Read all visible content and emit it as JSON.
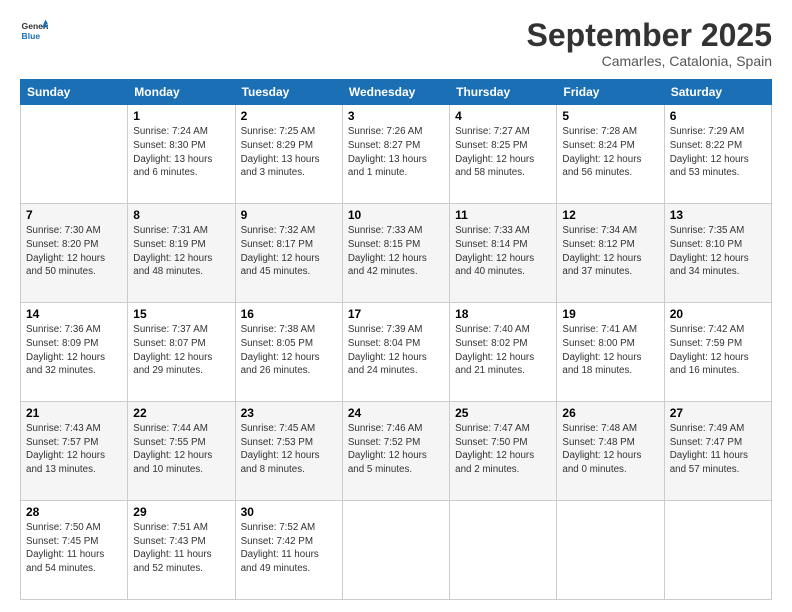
{
  "header": {
    "logo_line1": "General",
    "logo_line2": "Blue",
    "month": "September 2025",
    "location": "Camarles, Catalonia, Spain"
  },
  "weekdays": [
    "Sunday",
    "Monday",
    "Tuesday",
    "Wednesday",
    "Thursday",
    "Friday",
    "Saturday"
  ],
  "weeks": [
    [
      {
        "day": "",
        "info": ""
      },
      {
        "day": "1",
        "info": "Sunrise: 7:24 AM\nSunset: 8:30 PM\nDaylight: 13 hours\nand 6 minutes."
      },
      {
        "day": "2",
        "info": "Sunrise: 7:25 AM\nSunset: 8:29 PM\nDaylight: 13 hours\nand 3 minutes."
      },
      {
        "day": "3",
        "info": "Sunrise: 7:26 AM\nSunset: 8:27 PM\nDaylight: 13 hours\nand 1 minute."
      },
      {
        "day": "4",
        "info": "Sunrise: 7:27 AM\nSunset: 8:25 PM\nDaylight: 12 hours\nand 58 minutes."
      },
      {
        "day": "5",
        "info": "Sunrise: 7:28 AM\nSunset: 8:24 PM\nDaylight: 12 hours\nand 56 minutes."
      },
      {
        "day": "6",
        "info": "Sunrise: 7:29 AM\nSunset: 8:22 PM\nDaylight: 12 hours\nand 53 minutes."
      }
    ],
    [
      {
        "day": "7",
        "info": "Sunrise: 7:30 AM\nSunset: 8:20 PM\nDaylight: 12 hours\nand 50 minutes."
      },
      {
        "day": "8",
        "info": "Sunrise: 7:31 AM\nSunset: 8:19 PM\nDaylight: 12 hours\nand 48 minutes."
      },
      {
        "day": "9",
        "info": "Sunrise: 7:32 AM\nSunset: 8:17 PM\nDaylight: 12 hours\nand 45 minutes."
      },
      {
        "day": "10",
        "info": "Sunrise: 7:33 AM\nSunset: 8:15 PM\nDaylight: 12 hours\nand 42 minutes."
      },
      {
        "day": "11",
        "info": "Sunrise: 7:33 AM\nSunset: 8:14 PM\nDaylight: 12 hours\nand 40 minutes."
      },
      {
        "day": "12",
        "info": "Sunrise: 7:34 AM\nSunset: 8:12 PM\nDaylight: 12 hours\nand 37 minutes."
      },
      {
        "day": "13",
        "info": "Sunrise: 7:35 AM\nSunset: 8:10 PM\nDaylight: 12 hours\nand 34 minutes."
      }
    ],
    [
      {
        "day": "14",
        "info": "Sunrise: 7:36 AM\nSunset: 8:09 PM\nDaylight: 12 hours\nand 32 minutes."
      },
      {
        "day": "15",
        "info": "Sunrise: 7:37 AM\nSunset: 8:07 PM\nDaylight: 12 hours\nand 29 minutes."
      },
      {
        "day": "16",
        "info": "Sunrise: 7:38 AM\nSunset: 8:05 PM\nDaylight: 12 hours\nand 26 minutes."
      },
      {
        "day": "17",
        "info": "Sunrise: 7:39 AM\nSunset: 8:04 PM\nDaylight: 12 hours\nand 24 minutes."
      },
      {
        "day": "18",
        "info": "Sunrise: 7:40 AM\nSunset: 8:02 PM\nDaylight: 12 hours\nand 21 minutes."
      },
      {
        "day": "19",
        "info": "Sunrise: 7:41 AM\nSunset: 8:00 PM\nDaylight: 12 hours\nand 18 minutes."
      },
      {
        "day": "20",
        "info": "Sunrise: 7:42 AM\nSunset: 7:59 PM\nDaylight: 12 hours\nand 16 minutes."
      }
    ],
    [
      {
        "day": "21",
        "info": "Sunrise: 7:43 AM\nSunset: 7:57 PM\nDaylight: 12 hours\nand 13 minutes."
      },
      {
        "day": "22",
        "info": "Sunrise: 7:44 AM\nSunset: 7:55 PM\nDaylight: 12 hours\nand 10 minutes."
      },
      {
        "day": "23",
        "info": "Sunrise: 7:45 AM\nSunset: 7:53 PM\nDaylight: 12 hours\nand 8 minutes."
      },
      {
        "day": "24",
        "info": "Sunrise: 7:46 AM\nSunset: 7:52 PM\nDaylight: 12 hours\nand 5 minutes."
      },
      {
        "day": "25",
        "info": "Sunrise: 7:47 AM\nSunset: 7:50 PM\nDaylight: 12 hours\nand 2 minutes."
      },
      {
        "day": "26",
        "info": "Sunrise: 7:48 AM\nSunset: 7:48 PM\nDaylight: 12 hours\nand 0 minutes."
      },
      {
        "day": "27",
        "info": "Sunrise: 7:49 AM\nSunset: 7:47 PM\nDaylight: 11 hours\nand 57 minutes."
      }
    ],
    [
      {
        "day": "28",
        "info": "Sunrise: 7:50 AM\nSunset: 7:45 PM\nDaylight: 11 hours\nand 54 minutes."
      },
      {
        "day": "29",
        "info": "Sunrise: 7:51 AM\nSunset: 7:43 PM\nDaylight: 11 hours\nand 52 minutes."
      },
      {
        "day": "30",
        "info": "Sunrise: 7:52 AM\nSunset: 7:42 PM\nDaylight: 11 hours\nand 49 minutes."
      },
      {
        "day": "",
        "info": ""
      },
      {
        "day": "",
        "info": ""
      },
      {
        "day": "",
        "info": ""
      },
      {
        "day": "",
        "info": ""
      }
    ]
  ]
}
